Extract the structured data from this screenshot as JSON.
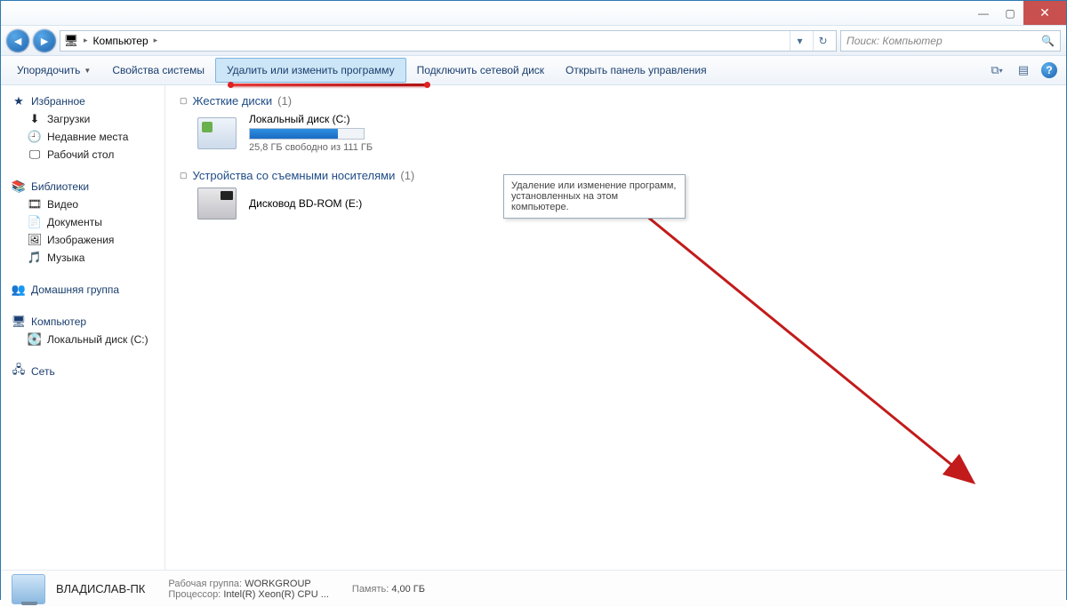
{
  "titlebar": {
    "minimize": "—",
    "maximize": "▢",
    "close": "✕"
  },
  "nav": {
    "location_label": "Компьютер",
    "breadcrumb_sep": "▸",
    "search_placeholder": "Поиск: Компьютер"
  },
  "toolbar": {
    "organize": "Упорядочить",
    "system_props": "Свойства системы",
    "uninstall": "Удалить или изменить программу",
    "map_drive": "Подключить сетевой диск",
    "control_panel": "Открыть панель управления"
  },
  "tooltip": {
    "text": "Удаление или изменение программ, установленных на этом компьютере."
  },
  "sidebar": {
    "favorites": "Избранное",
    "downloads": "Загрузки",
    "recent": "Недавние места",
    "desktop": "Рабочий стол",
    "libraries": "Библиотеки",
    "video": "Видео",
    "documents": "Документы",
    "pictures": "Изображения",
    "music": "Музыка",
    "homegroup": "Домашняя группа",
    "computer": "Компьютер",
    "local_c": "Локальный диск (C:)",
    "network": "Сеть"
  },
  "content": {
    "hdd_header": "Жесткие диски",
    "hdd_count": "(1)",
    "local_c_name": "Локальный диск (C:)",
    "local_c_free": "25,8 ГБ свободно из 111 ГБ",
    "local_c_used_pct": 77,
    "removable_header": "Устройства со съемными носителями",
    "removable_count": "(1)",
    "bd_name": "Дисковод BD-ROM (E:)"
  },
  "status": {
    "pc_name": "ВЛАДИСЛАВ-ПК",
    "workgroup_label": "Рабочая группа:",
    "workgroup": "WORKGROUP",
    "cpu_label": "Процессор:",
    "cpu": "Intel(R) Xeon(R) CPU    ...",
    "mem_label": "Память:",
    "mem": "4,00 ГБ"
  }
}
